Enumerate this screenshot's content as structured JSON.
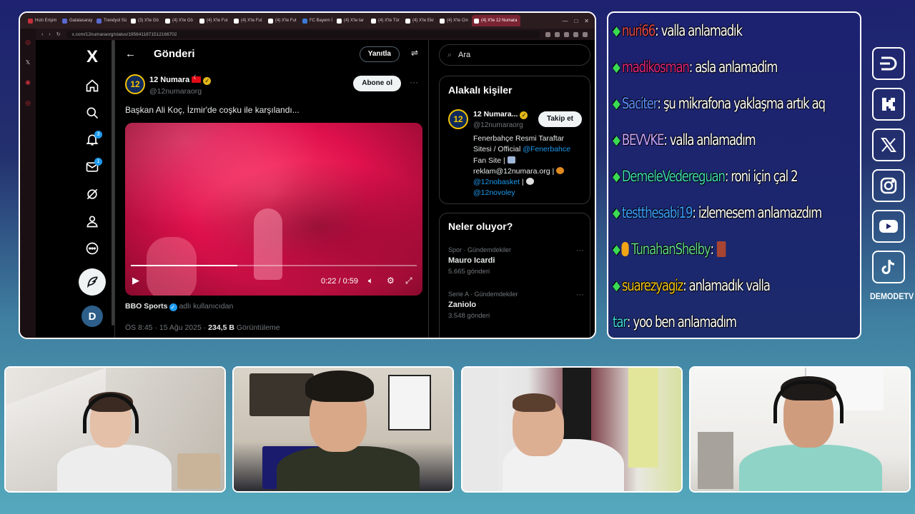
{
  "browser": {
    "tabs": [
      {
        "label": "Hızlı Erişim",
        "color": "#c5303c"
      },
      {
        "label": "Galatasaray",
        "color": "#5a6ad0"
      },
      {
        "label": "Trendyol Sü",
        "color": "#5a6ad0"
      },
      {
        "label": "(3) X'te Gö",
        "color": "#ffffff"
      },
      {
        "label": "(4) X'te Gö",
        "color": "#ffffff"
      },
      {
        "label": "(4) X'te Fut",
        "color": "#ffffff"
      },
      {
        "label": "(4) X'te Fut",
        "color": "#ffffff"
      },
      {
        "label": "(4) X'te Fut",
        "color": "#ffffff"
      },
      {
        "label": "FC Bayern İ",
        "color": "#3b7bd6"
      },
      {
        "label": "(4) X'te tar",
        "color": "#ffffff"
      },
      {
        "label": "(4) X'te Tür",
        "color": "#ffffff"
      },
      {
        "label": "(4) X'te Ekr",
        "color": "#ffffff"
      },
      {
        "label": "(4) X'te Cin",
        "color": "#ffffff"
      }
    ],
    "active_tab": "(4) X'te 12 Numara",
    "url": "x.com/12numaraorg/status/1956411871512166702"
  },
  "xnav": {
    "logo": "X",
    "notifications_badge": "3",
    "messages_badge": "1",
    "account_initial": "D"
  },
  "main": {
    "back_glyph": "←",
    "title": "Gönderi",
    "reply_label": "Yanıtla",
    "author_name": "12 Numara",
    "author_handle": "@12numaraorg",
    "avatar_text": "12",
    "subscribe_label": "Abone ol",
    "more_glyph": "···",
    "tweet_text": "Başkan Ali Koç, İzmir'de coşku ile karşılandı...",
    "video": {
      "time": "0:22 / 0:59",
      "progress_fraction": 0.373
    },
    "attribution_user": "BBO Sports",
    "attribution_suffix": "adlı kullanıcıdan",
    "time_date": "ÖS 8:45 · 15 Ağu 2025 · ",
    "views_count": "234,5 B",
    "views_label": " Görüntüleme"
  },
  "sidebar": {
    "search_placeholder": "Ara",
    "related_title": "Alakalı kişiler",
    "related_name": "12 Numara...",
    "related_handle": "@12numaraorg",
    "follow_label": "Takip et",
    "bio": {
      "line1": "Fenerbahçe Resmi Taraftar",
      "line2": "Sitesi / Official ",
      "link1": "@Fenerbahce",
      "line3": "Fan Site | ",
      "line4": "reklam@12numara.org | ",
      "link2": "@12nobasket",
      "sep": " | ",
      "link3": "@12novoley"
    },
    "trends_title": "Neler oluyor?",
    "trends": [
      {
        "context": "Spor · Gündemdekiler",
        "topic": "Mauro Icardi",
        "count": "5.665 gönderi"
      },
      {
        "context": "Serie A · Gündemdekiler",
        "topic": "Zaniolo",
        "count": "3.548 gönderi"
      }
    ]
  },
  "chat": {
    "messages": [
      {
        "user": "nuri66",
        "color": "#e0484b",
        "text": " : valla anlamadık",
        "badge": "gem"
      },
      {
        "user": "madikosman",
        "color": "#e0247a",
        "text": " : asla anlamadim",
        "badge": "gem"
      },
      {
        "user": "Saciter",
        "color": "#5b8fff",
        "text": " : şu mikrafona yaklaşma artık aq",
        "badge": "gem"
      },
      {
        "user": "BEVVKE",
        "color": "#c7a3ff",
        "text": " : valla anlamadım",
        "badge": "gem"
      },
      {
        "user": "DemeleVedereguan",
        "color": "#3fd6b0",
        "text": " : roni için çal 2",
        "badge": "gem"
      },
      {
        "user": "testthesabi19",
        "color": "#3aa0ff",
        "text": " : izlemesem anlamazdım",
        "badge": "gem"
      },
      {
        "user": "TunahanShelby",
        "color": "#5fd48a",
        "text": " : ",
        "badge": "gem-coin",
        "emoji": true
      },
      {
        "user": "suarezyagiz",
        "color": "#f0c419",
        "text": " : anlamadık valla",
        "badge": "gem"
      },
      {
        "user": "tar",
        "color": "#3fd6e0",
        "text": " : yoo ben anlamadım",
        "badge": "none"
      }
    ]
  },
  "social": {
    "icons": [
      "demode-icon",
      "kick-icon",
      "x-icon",
      "instagram-icon",
      "youtube-icon",
      "tiktok-icon"
    ],
    "channel_name": "DEMODETV"
  }
}
